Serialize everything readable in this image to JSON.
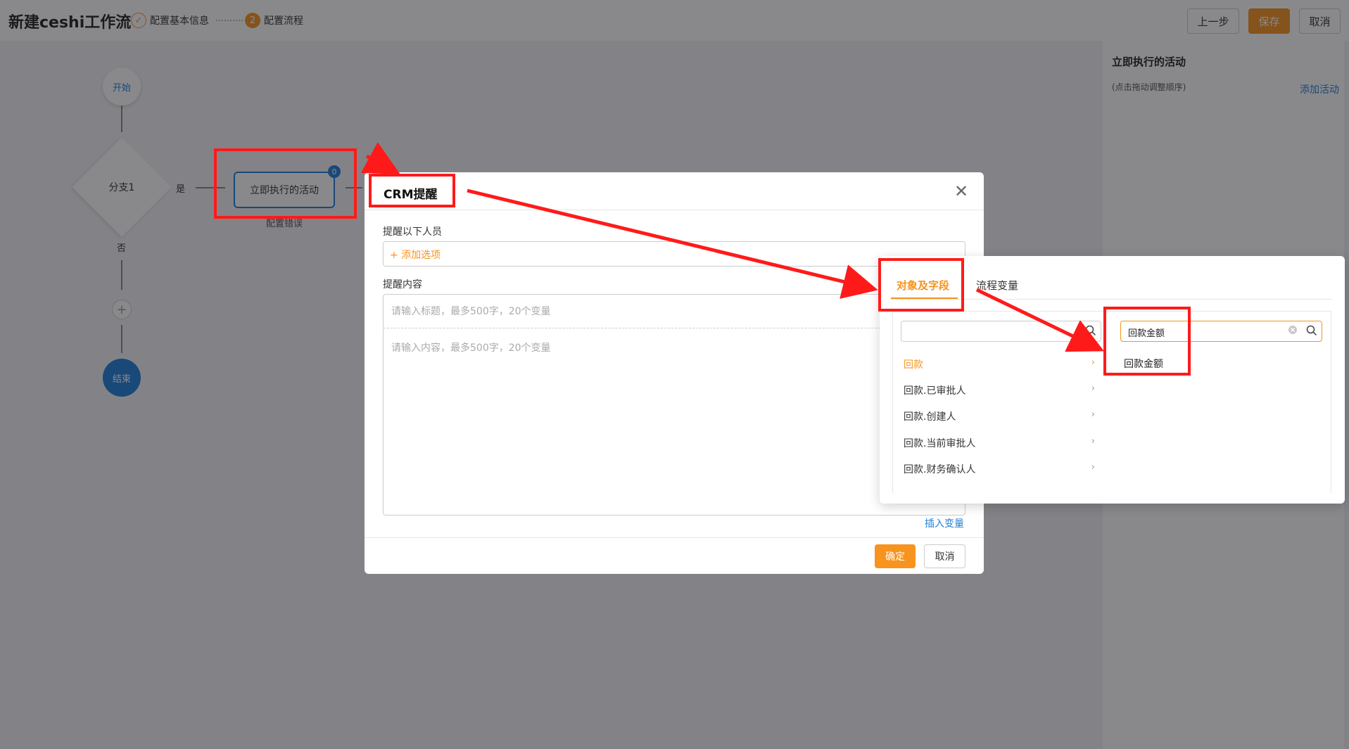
{
  "header": {
    "title": "新建ceshi工作流",
    "steps": [
      {
        "num": "✓",
        "label": "配置基本信息"
      },
      {
        "num": "2",
        "label": "配置流程"
      }
    ],
    "buttons": {
      "prev": "上一步",
      "save": "保存",
      "cancel": "取消"
    }
  },
  "flow": {
    "start": "开始",
    "branch": "分支1",
    "yes": "是",
    "no": "否",
    "plus": "+",
    "activity": "立即执行的活动",
    "badge": "0",
    "error": "配置错误",
    "end": "结束"
  },
  "right_panel": {
    "title": "立即执行的活动",
    "hint": "(点击拖动调整顺序)",
    "add_label": "添加活动"
  },
  "modal": {
    "title": "CRM提醒",
    "close_icon": "close-icon",
    "remind_label": "提醒以下人员",
    "add_option": "+ 添加选项",
    "content_label": "提醒内容",
    "title_placeholder": "请输入标题，最多500字，20个变量",
    "content_placeholder": "请输入内容，最多500字，20个变量",
    "insert_variable": "插入变量",
    "ok": "确定",
    "cancel": "取消"
  },
  "popover": {
    "tabs": [
      {
        "label": "对象及字段",
        "active": true
      },
      {
        "label": "流程变量",
        "active": false
      }
    ],
    "left_search_value": "",
    "right_search_value": "回款金额",
    "objects": [
      {
        "label": "回款",
        "active": true
      },
      {
        "label": "回款.已审批人",
        "active": false
      },
      {
        "label": "回款.创建人",
        "active": false
      },
      {
        "label": "回款.当前审批人",
        "active": false
      },
      {
        "label": "回款.财务确认人",
        "active": false
      }
    ],
    "field_results": [
      "回款金额"
    ]
  },
  "colors": {
    "accent": "#f7931e",
    "link": "#1f7fd8",
    "annotation": "#ff1a1a"
  }
}
